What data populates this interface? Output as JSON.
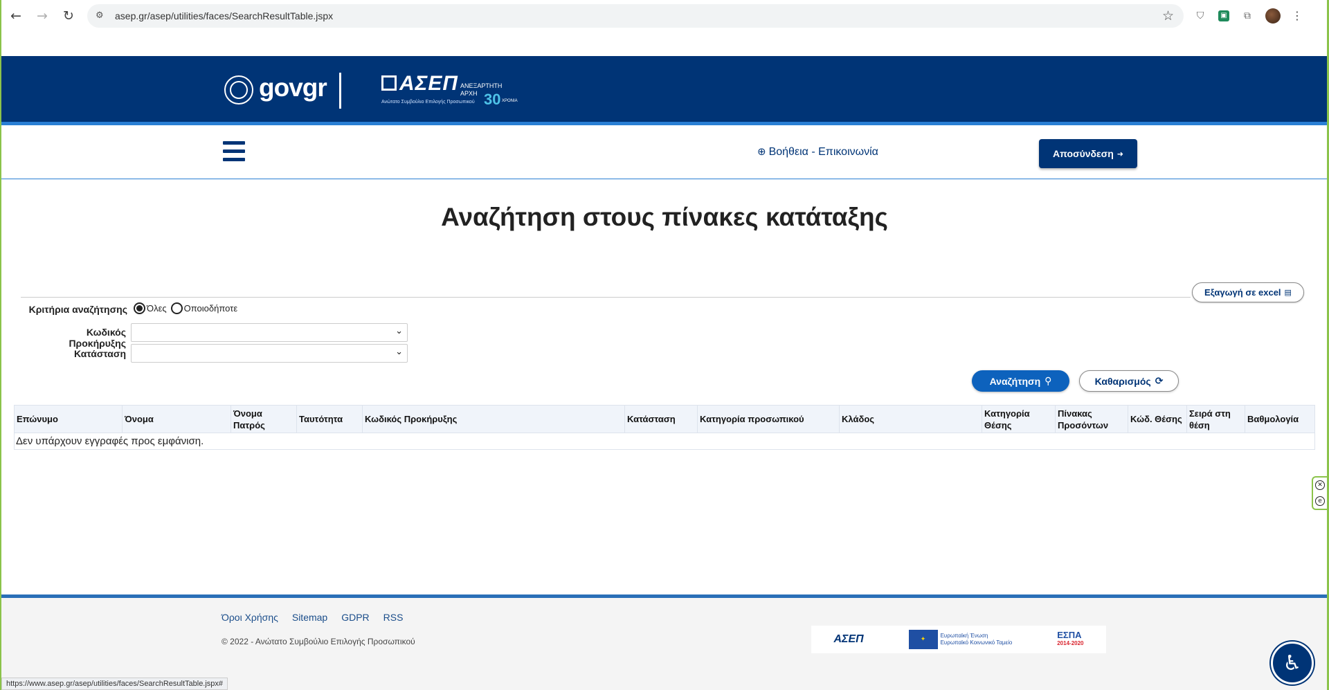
{
  "browser": {
    "url": "asep.gr/asep/utilities/faces/SearchResultTable.jspx",
    "status_url": "https://www.asep.gr/asep/utilities/faces/SearchResultTable.jspx#"
  },
  "header": {
    "gov_logo_text": "gov",
    "gov_logo_suffix": "gr",
    "asep_logo_text": "ΑΣΕΠ",
    "asep_logo_sub": "Ανώτατο Συμβούλιο Επιλογής Προσωπικού",
    "asep_logo_independent": "ΑΝΕΞΑΡΤΗΤΗ ΑΡΧΗ",
    "asep_logo_30": "30",
    "asep_logo_years": "ΧΡΟΝΙΑ"
  },
  "nav": {
    "help_label": "Βοήθεια - Επικοινωνία",
    "logout_label": "Αποσύνδεση"
  },
  "page": {
    "title": "Αναζήτηση στους πίνακες κατάταξης",
    "export_label": "Εξαγωγή σε excel"
  },
  "form": {
    "criteria_label": "Κριτήρια αναζήτησης",
    "radio_all": "Όλες",
    "radio_any": "Οποιοδήποτε",
    "announcement_label": "Κωδικός Προκήρυξης",
    "announcement_value": "",
    "status_label": "Κατάσταση",
    "status_value": "",
    "search_label": "Αναζήτηση",
    "clear_label": "Καθαρισμός"
  },
  "table": {
    "columns": [
      "Επώνυμο",
      "Όνομα",
      "Όνομα Πατρός",
      "Ταυτότητα",
      "Κωδικός Προκήρυξης",
      "Κατάσταση",
      "Κατηγορία προσωπικού",
      "Κλάδος",
      "Κατηγορία Θέσης",
      "Πίνακας Προσόντων",
      "Κώδ. Θέσης",
      "Σειρά στη θέση",
      "Βαθμολογία"
    ],
    "empty_message": "Δεν υπάρχουν εγγραφές προς εμφάνιση."
  },
  "footer": {
    "links": [
      "Όροι Χρήσης",
      "Sitemap",
      "GDPR",
      "RSS"
    ],
    "copyright": "© 2022 - Ανώτατο Συμβούλιο Επιλογής Προσωπικού",
    "partner_asep": "ΑΣΕΠ",
    "partner_eu": "Ευρωπαϊκή Ένωση",
    "partner_eu_sub": "Ευρωπαϊκό Κοινωνικό Ταμείο",
    "partner_espa": "ΕΣΠΑ",
    "partner_espa_years": "2014-2020"
  },
  "colors": {
    "brand_dark": "#003476",
    "accent_blue": "#0d62bd",
    "header_stripe": "#2a7fd4"
  },
  "icons": {
    "back": "arrow-left",
    "forward": "arrow-right",
    "reload": "refresh",
    "bookmark": "star",
    "help": "life-ring",
    "logout": "sign-out",
    "excel": "file-excel",
    "search": "magnifier",
    "clear": "refresh",
    "accessibility": "wheelchair"
  }
}
